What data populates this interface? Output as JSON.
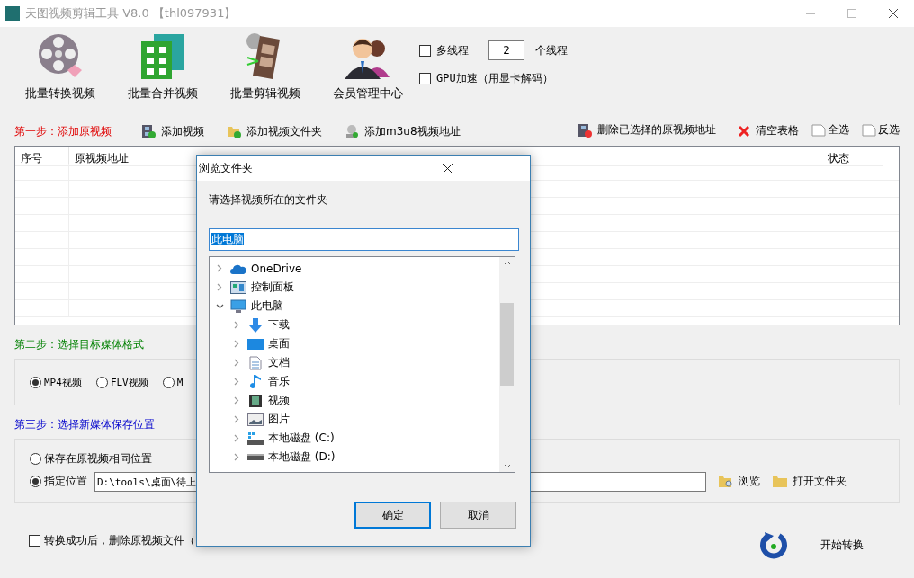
{
  "window": {
    "title": "天图视频剪辑工具 V8.0 【thl097931】"
  },
  "toolbar": [
    {
      "label": "批量转换视频",
      "kind": "convert"
    },
    {
      "label": "批量合并视频",
      "kind": "merge"
    },
    {
      "label": "批量剪辑视频",
      "kind": "edit"
    },
    {
      "label": "会员管理中心",
      "kind": "members"
    }
  ],
  "options": {
    "multithread": {
      "label": "多线程",
      "checked": false
    },
    "threads": {
      "value": "2",
      "unit": "个线程"
    },
    "gpu": {
      "label": "GPU加速（用显卡解码）",
      "checked": false
    }
  },
  "step1": {
    "label": "第一步：添加原视频",
    "actions_left": [
      {
        "label": "添加视频",
        "kind": "add-video"
      },
      {
        "label": "添加视频文件夹",
        "kind": "add-folder"
      },
      {
        "label": "添加m3u8视频地址",
        "kind": "add-url"
      }
    ],
    "actions_right": [
      {
        "label": "删除已选择的原视频地址",
        "kind": "delete"
      },
      {
        "label": "清空表格",
        "kind": "clear"
      },
      {
        "label": "全选",
        "kind": "page"
      },
      {
        "label": "反选",
        "kind": "page"
      }
    ]
  },
  "table": {
    "columns": [
      "序号",
      "原视频地址",
      "状态"
    ]
  },
  "step2": {
    "label": "第二步：选择目标媒体格式",
    "formats": [
      {
        "label": "MP4视频",
        "selected": true
      },
      {
        "label": "FLV视频",
        "selected": false
      },
      {
        "label": "M",
        "selected": false
      }
    ]
  },
  "step3": {
    "label": "第三步：选择新媒体保存位置",
    "locations": [
      {
        "label": "保存在原视频相同位置",
        "selected": false
      },
      {
        "label": "指定位置",
        "selected": true
      }
    ],
    "path": "D:\\tools\\桌面\\待上",
    "browse": "浏览",
    "open_folder": "打开文件夹"
  },
  "delete_after": {
    "label": "转换成功后，删除原视频文件（",
    "checked": false
  },
  "start": {
    "label": "开始转换"
  },
  "dialog": {
    "title": "浏览文件夹",
    "prompt": "请选择视频所在的文件夹",
    "folder": "此电脑",
    "tree": [
      {
        "label": "OneDrive",
        "kind": "cloud",
        "expanded": false
      },
      {
        "label": "控制面板",
        "kind": "panel",
        "expanded": false
      },
      {
        "label": "此电脑",
        "kind": "computer",
        "expanded": true,
        "children": [
          {
            "label": "下载",
            "kind": "download",
            "expanded": false
          },
          {
            "label": "桌面",
            "kind": "desktop",
            "expanded": false
          },
          {
            "label": "文档",
            "kind": "document",
            "expanded": false
          },
          {
            "label": "音乐",
            "kind": "music",
            "expanded": false
          },
          {
            "label": "视频",
            "kind": "video",
            "expanded": false
          },
          {
            "label": "图片",
            "kind": "image",
            "expanded": false
          },
          {
            "label": "本地磁盘 (C:)",
            "kind": "system-drive",
            "expanded": false
          },
          {
            "label": "本地磁盘 (D:)",
            "kind": "drive",
            "expanded": false
          }
        ]
      }
    ],
    "buttons": [
      {
        "label": "确定",
        "kind": "default"
      },
      {
        "label": "取消",
        "kind": "normal"
      }
    ]
  }
}
